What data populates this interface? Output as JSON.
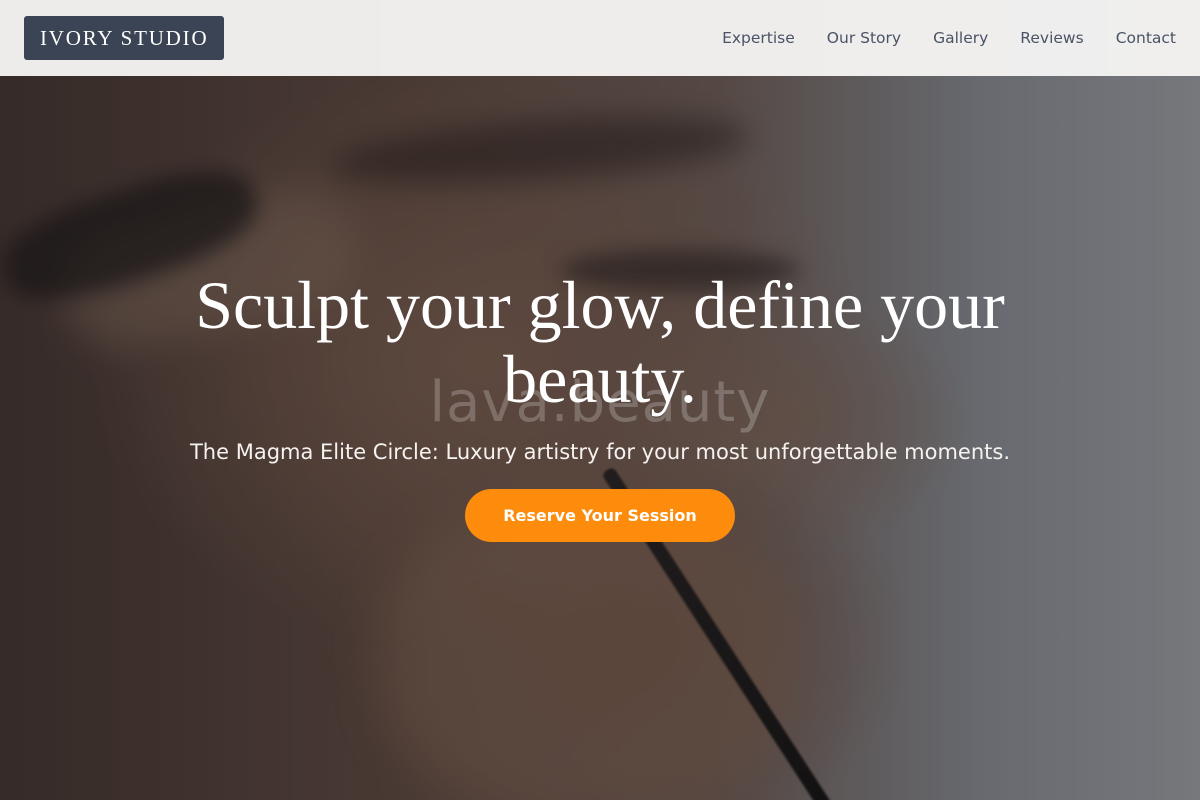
{
  "header": {
    "logo_text": "IVORY STUDIO",
    "nav": [
      {
        "label": "Expertise"
      },
      {
        "label": "Our Story"
      },
      {
        "label": "Gallery"
      },
      {
        "label": "Reviews"
      },
      {
        "label": "Contact"
      }
    ]
  },
  "hero": {
    "headline": "Sculpt your glow, define your beauty.",
    "watermark": "lava.beauty",
    "subtitle": "The Magma Elite Circle: Luxury artistry for your most unforgettable moments.",
    "cta_label": "Reserve Your Session"
  },
  "colors": {
    "header_bg": "#f4f3f2",
    "logo_bg": "#3b4455",
    "nav_text": "#4a5365",
    "cta_bg": "#fd8c0d",
    "hero_text": "#ffffff"
  }
}
